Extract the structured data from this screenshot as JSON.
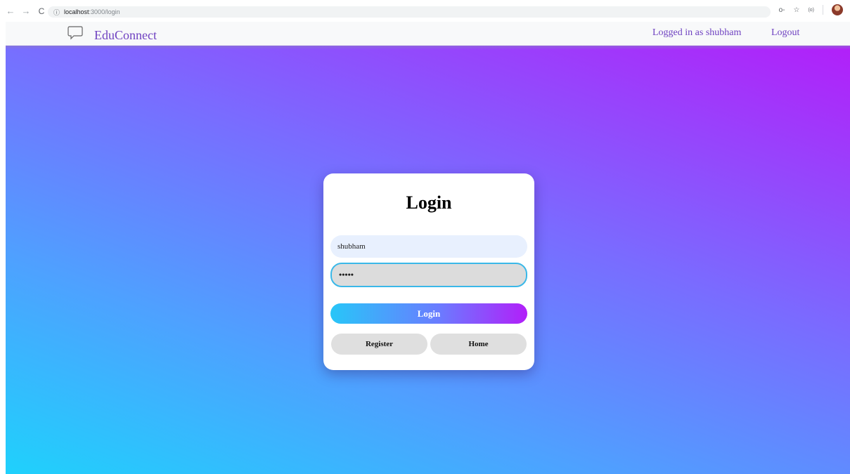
{
  "browser": {
    "url_host": "localhost",
    "url_path": ":3000/login",
    "back_icon": "←",
    "forward_icon": "→",
    "reload_icon": "C",
    "info_icon": "ⓘ",
    "key_icon": "o-",
    "star_icon": "☆",
    "ext_icon": "(o)"
  },
  "navbar": {
    "brand": "EduConnect",
    "logged_in_text": "Logged in as shubham",
    "logout_label": "Logout"
  },
  "login_card": {
    "title": "Login",
    "username_value": "shubham",
    "password_mask": "•••••",
    "login_button": "Login",
    "register_button": "Register",
    "home_button": "Home"
  },
  "colors": {
    "brand": "#6f42c1",
    "gradient_start": "#1fd1fc",
    "gradient_end": "#b21ff9"
  }
}
